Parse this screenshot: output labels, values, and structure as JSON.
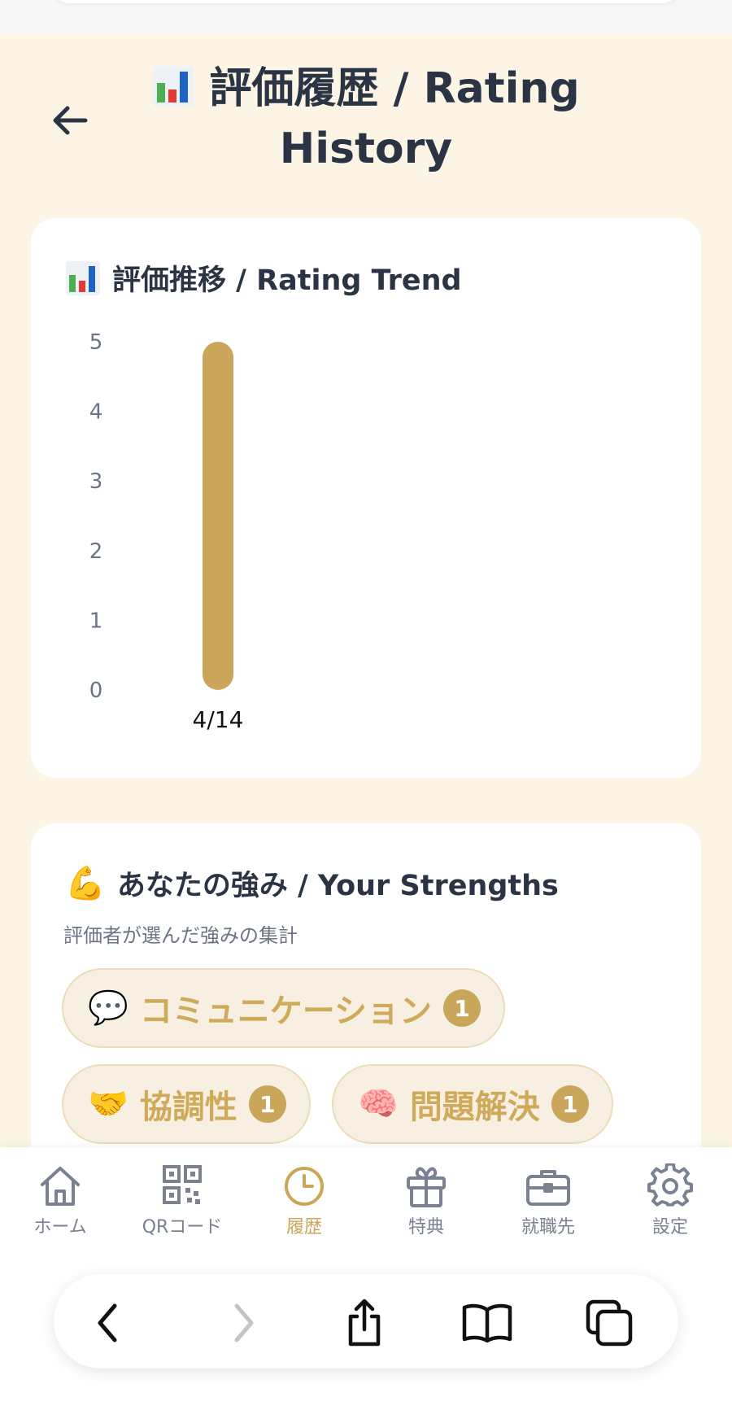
{
  "header": {
    "title": "評価履歴 / Rating History",
    "title_emoji": "📊"
  },
  "trend_card": {
    "title": "評価推移 / Rating Trend",
    "emoji": "📊"
  },
  "chart_data": {
    "type": "bar",
    "categories": [
      "4/14"
    ],
    "values": [
      5
    ],
    "ylim": [
      0,
      5
    ],
    "yticks": [
      "0",
      "1",
      "2",
      "3",
      "4",
      "5"
    ],
    "bar_color": "#cba65a",
    "grid": false
  },
  "strengths_card": {
    "title": "あなたの強み / Your Strengths",
    "emoji": "💪",
    "subtitle": "評価者が選んだ強みの集計",
    "tags": [
      {
        "emoji": "💬",
        "label": "コミュニケーション",
        "count": "1"
      },
      {
        "emoji": "🤝",
        "label": "協調性",
        "count": "1"
      },
      {
        "emoji": "🧠",
        "label": "問題解決",
        "count": "1"
      }
    ]
  },
  "tabbar": {
    "items": [
      {
        "label": "ホーム",
        "icon": "home-icon",
        "active": false
      },
      {
        "label": "QRコード",
        "icon": "qr-code-icon",
        "active": false
      },
      {
        "label": "履歴",
        "icon": "clock-icon",
        "active": true
      },
      {
        "label": "特典",
        "icon": "gift-icon",
        "active": false
      },
      {
        "label": "就職先",
        "icon": "briefcase-icon",
        "active": false
      },
      {
        "label": "設定",
        "icon": "gear-icon",
        "active": false
      }
    ]
  },
  "colors": {
    "accent": "#cba65a",
    "background": "#fcf5e5",
    "text_dark": "#2b3445",
    "text_muted": "#7a8292"
  }
}
